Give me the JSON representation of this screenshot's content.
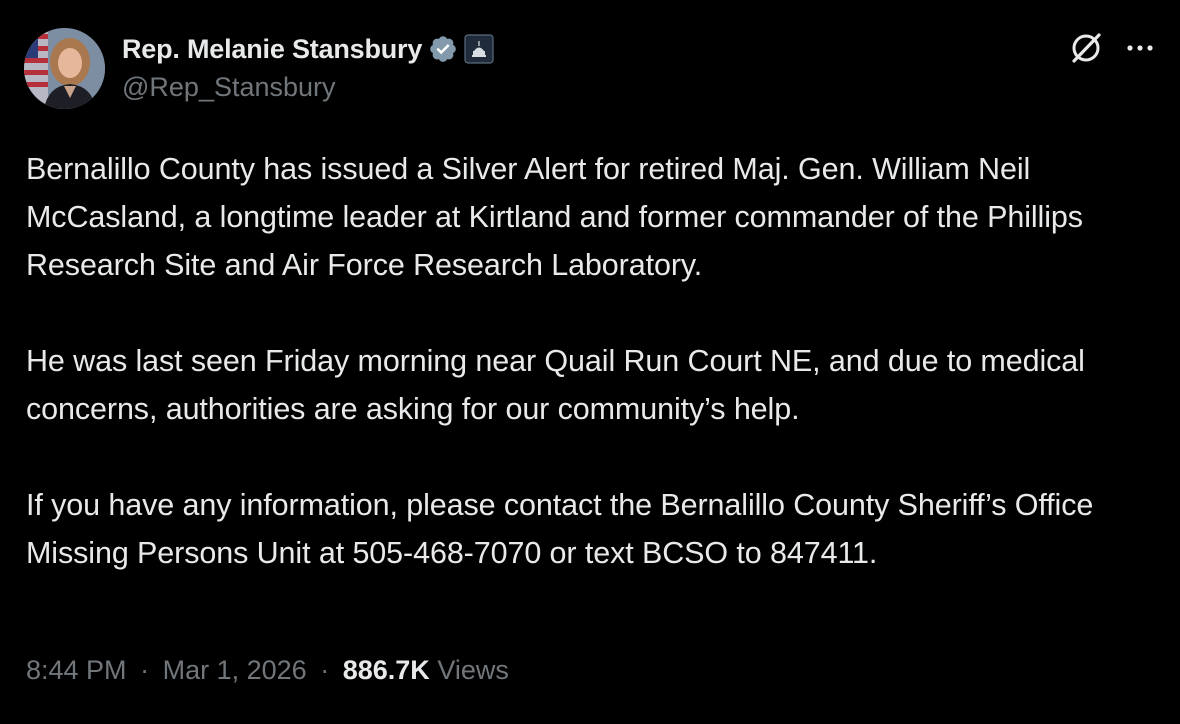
{
  "author": {
    "display_name": "Rep. Melanie Stansbury",
    "handle": "@Rep_Stansbury",
    "verified_icon": "verified-badge-icon",
    "affiliation_icon": "government-capitol-icon",
    "colors": {
      "verified_badge": "#829aab",
      "handle_gray": "#71767b"
    }
  },
  "actions": {
    "grok_icon": "grok-icon",
    "more_icon": "more-options-icon"
  },
  "tweet": {
    "paragraphs": [
      "Bernalillo County has issued a Silver Alert for retired Maj. Gen. William Neil McCasland, a longtime leader at Kirtland and former commander of the Phillips Research Site and Air Force Research Laboratory.",
      "He was last seen Friday morning near Quail Run Court NE, and due to medical concerns, authorities are asking for our community’s help.",
      "If you have any information, please contact the Bernalillo County Sheriff’s Office Missing Persons Unit at 505-468-7070 or text BCSO to 847411."
    ]
  },
  "meta": {
    "time": "8:44 PM",
    "separator": "·",
    "date": "Mar 1, 2026",
    "views_count": "886.7K",
    "views_label": "Views"
  },
  "theme": {
    "background": "#000000",
    "text": "#e7e9ea",
    "muted": "#71767b"
  }
}
